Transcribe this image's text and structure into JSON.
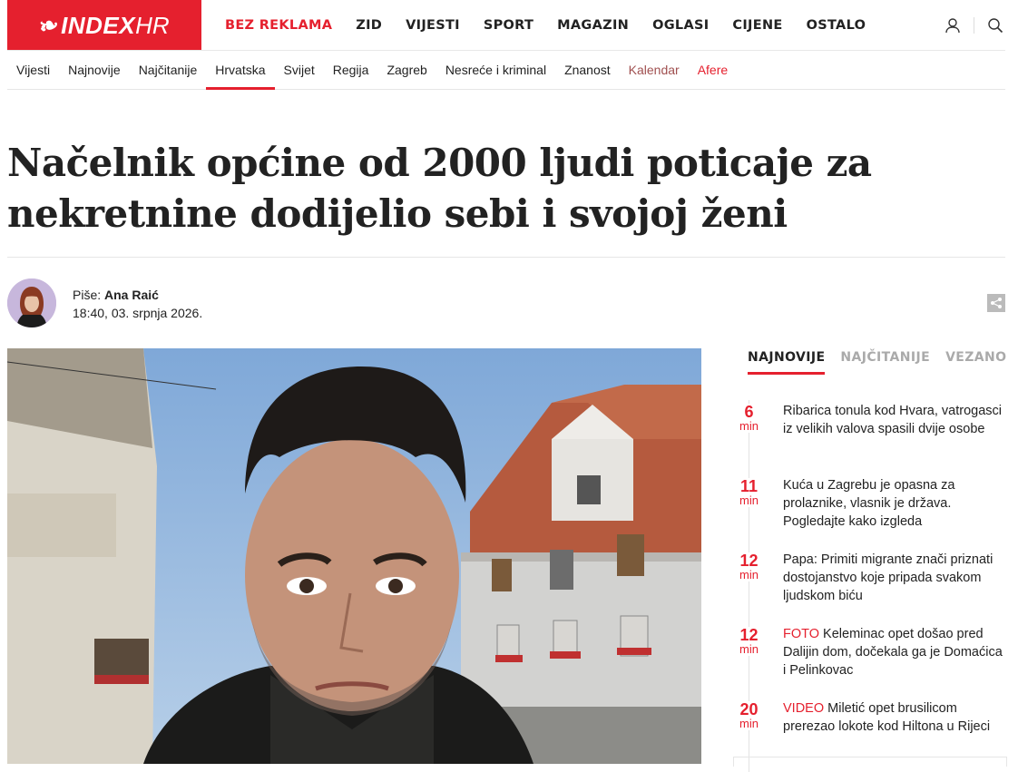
{
  "logo": {
    "brand": "INDEX",
    "suffix": "HR"
  },
  "main_nav": [
    {
      "label": "BEZ REKLAMA",
      "accent": true
    },
    {
      "label": "ZID"
    },
    {
      "label": "VIJESTI"
    },
    {
      "label": "SPORT"
    },
    {
      "label": "MAGAZIN"
    },
    {
      "label": "OGLASI"
    },
    {
      "label": "CIJENE"
    },
    {
      "label": "OSTALO"
    }
  ],
  "sub_nav": [
    {
      "label": "Vijesti"
    },
    {
      "label": "Najnovije"
    },
    {
      "label": "Najčitanije"
    },
    {
      "label": "Hrvatska",
      "active": true
    },
    {
      "label": "Svijet"
    },
    {
      "label": "Regija"
    },
    {
      "label": "Zagreb"
    },
    {
      "label": "Nesreće i kriminal"
    },
    {
      "label": "Znanost"
    },
    {
      "label": "Kalendar",
      "muted": true
    },
    {
      "label": "Afere",
      "red": true
    }
  ],
  "article": {
    "title": "Načelnik općine od 2000 ljudi poticaje za nekretnine dodijelio sebi i svojoj ženi",
    "author_prefix": "Piše:",
    "author": "Ana Raić",
    "datetime": "18:40, 03. srpnja 2026."
  },
  "sidebar": {
    "tabs": [
      "NAJNOVIJE",
      "NAJČITANIJE",
      "VEZANO"
    ],
    "active_tab": 0,
    "items": [
      {
        "time": "6",
        "unit": "min",
        "tag": "",
        "text": "Ribarica tonula kod Hvara, vatrogasci iz velikih valova spasili dvije osobe"
      },
      {
        "time": "11",
        "unit": "min",
        "tag": "",
        "text": "Kuća u Zagrebu je opasna za prolaznike, vlasnik je država. Pogledajte kako izgleda"
      },
      {
        "time": "12",
        "unit": "min",
        "tag": "",
        "text": "Papa: Primiti migrante znači priznati dostojanstvo koje pripada svakom ljudskom biću"
      },
      {
        "time": "12",
        "unit": "min",
        "tag": "FOTO",
        "text": "Keleminac opet došao pred Dalijin dom, dočekala ga je Domaćica i Pelinkovac"
      },
      {
        "time": "20",
        "unit": "min",
        "tag": "VIDEO",
        "text": "Miletić opet brusilicom prerezao lokote kod Hiltona u Rijeci"
      }
    ]
  },
  "colors": {
    "brand_red": "#e5202e"
  }
}
